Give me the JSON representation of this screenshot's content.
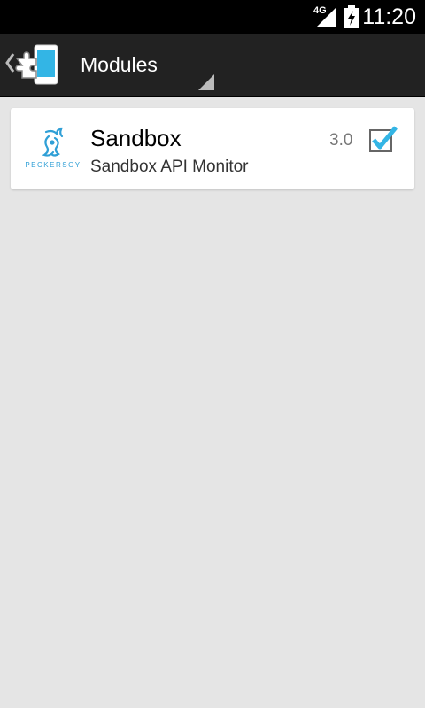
{
  "status_bar": {
    "network": "4G",
    "time": "11:20"
  },
  "action_bar": {
    "title": "Modules",
    "up_icon": "chevron-left-icon",
    "app_icon": "xposed-puzzle-icon",
    "spinner_icon": "spinner-triangle-icon"
  },
  "modules": [
    {
      "name": "Sandbox",
      "description": "Sandbox API Monitor",
      "version": "3.0",
      "enabled": true,
      "icon": "peckersoy-logo",
      "icon_text": "PECKERSOY"
    }
  ],
  "colors": {
    "status_bar": "#000000",
    "action_bar": "#222222",
    "background": "#e5e5e5",
    "card": "#ffffff",
    "accent": "#33b5e5",
    "logo": "#2f9fd6"
  }
}
